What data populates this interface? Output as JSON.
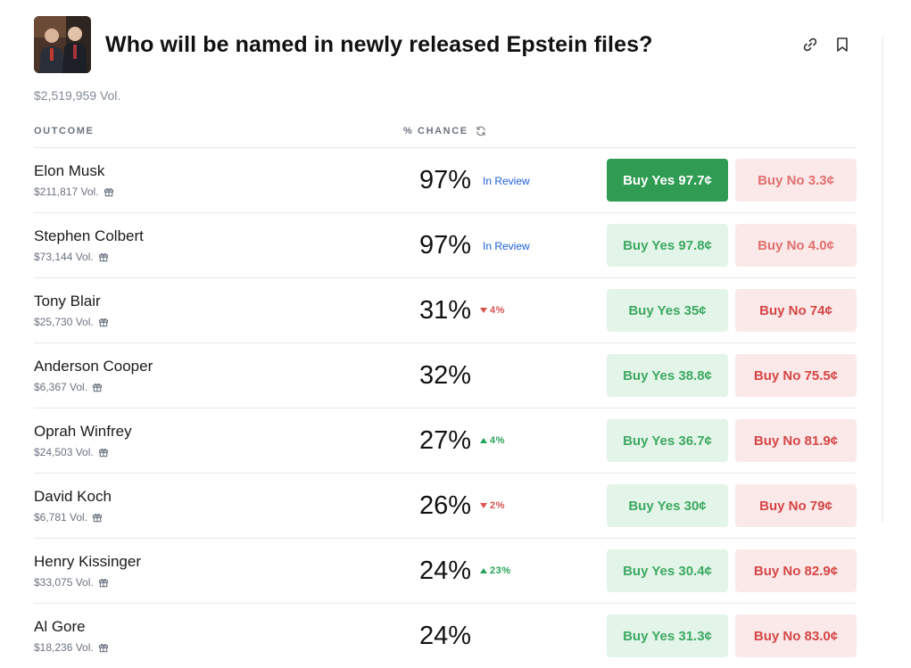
{
  "header": {
    "title": "Who will be named in newly released Epstein files?",
    "volume": "$2,519,959 Vol."
  },
  "columns": {
    "outcome": "OUTCOME",
    "chance": "% CHANCE"
  },
  "outcomes": [
    {
      "name": "Elon Musk",
      "volume": "$211,817 Vol.",
      "chance": "97%",
      "status": "In Review",
      "delta": "",
      "yes": "Buy Yes 97.7¢",
      "no": "Buy No 3.3¢"
    },
    {
      "name": "Stephen Colbert",
      "volume": "$73,144 Vol.",
      "chance": "97%",
      "status": "In Review",
      "delta": "",
      "yes": "Buy Yes 97.8¢",
      "no": "Buy No 4.0¢"
    },
    {
      "name": "Tony Blair",
      "volume": "$25,730 Vol.",
      "chance": "31%",
      "status": "",
      "delta": "4%",
      "yes": "Buy Yes 35¢",
      "no": "Buy No 74¢"
    },
    {
      "name": "Anderson Cooper",
      "volume": "$6,367 Vol.",
      "chance": "32%",
      "status": "",
      "delta": "",
      "yes": "Buy Yes 38.8¢",
      "no": "Buy No 75.5¢"
    },
    {
      "name": "Oprah Winfrey",
      "volume": "$24,503 Vol.",
      "chance": "27%",
      "status": "",
      "delta": "4%",
      "yes": "Buy Yes 36.7¢",
      "no": "Buy No 81.9¢"
    },
    {
      "name": "David Koch",
      "volume": "$6,781 Vol.",
      "chance": "26%",
      "status": "",
      "delta": "2%",
      "yes": "Buy Yes 30¢",
      "no": "Buy No 79¢"
    },
    {
      "name": "Henry Kissinger",
      "volume": "$33,075 Vol.",
      "chance": "24%",
      "status": "",
      "delta": "23%",
      "yes": "Buy Yes 30.4¢",
      "no": "Buy No 82.9¢"
    },
    {
      "name": "Al Gore",
      "volume": "$18,236 Vol.",
      "chance": "24%",
      "status": "",
      "delta": "",
      "yes": "Buy Yes 31.3¢",
      "no": "Buy No 83.0¢"
    }
  ],
  "colors": {
    "yes_active": "#2f9b53",
    "yes_bg": "#e3f5e8",
    "no_bg": "#fbe9e9",
    "review": "#1d5fd6",
    "down": "#d9534f",
    "up": "#27a35a"
  },
  "icons": [
    "link-icon",
    "bookmark-icon",
    "refresh-icon",
    "gift-icon",
    "triangle-down-icon",
    "triangle-up-icon"
  ]
}
